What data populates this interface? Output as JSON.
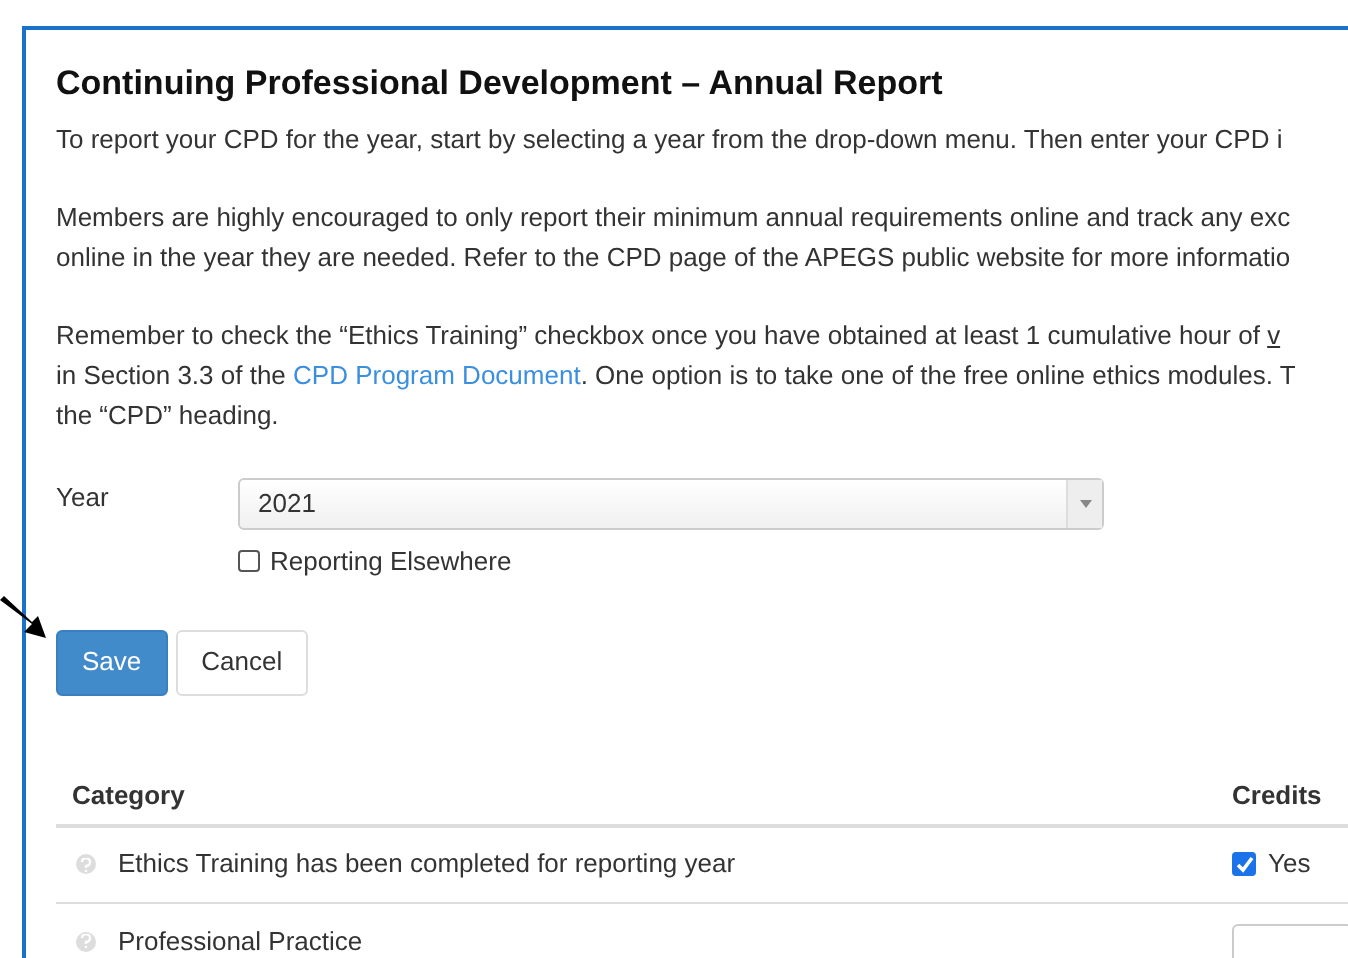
{
  "title": "Continuing Professional Development – Annual Report",
  "paragraphs": [
    [
      [
        {
          "text": "To report your CPD for the year, start by selecting a year from the drop-down menu. Then enter your CPD i"
        }
      ]
    ],
    [
      [
        {
          "text": "Members are highly encouraged to only report their minimum annual requirements online and track any exc"
        }
      ],
      [
        {
          "text": "online in the year they are needed. Refer to the CPD page of the APEGS public website for more informatio"
        }
      ]
    ],
    [
      [
        {
          "text": "Remember to check the “Ethics Training” checkbox once you have obtained at least 1 cumulative hour of "
        },
        {
          "text": "v",
          "link": true
        }
      ],
      [
        {
          "text": "in Section 3.3 of the "
        },
        {
          "text": "CPD Program Document",
          "link": true
        },
        {
          "text": ". One option is to take one of the free online ethics modules. T"
        }
      ],
      [
        {
          "text": "the “CPD” heading."
        }
      ]
    ]
  ],
  "year": {
    "label": "Year",
    "value": "2021"
  },
  "reporting_elsewhere": {
    "label": "Reporting Elsewhere",
    "checked": false
  },
  "buttons": [
    {
      "label": "Save",
      "kind": "primary"
    },
    {
      "label": "Cancel",
      "kind": "default"
    }
  ],
  "table": {
    "columns": [
      "Category",
      "Credits"
    ],
    "rows": [
      {
        "category": "Ethics Training has been completed for reporting year",
        "kind": "checkbox",
        "checked": true,
        "value": "Yes"
      },
      {
        "category": "Professional Practice",
        "kind": "input"
      }
    ]
  }
}
